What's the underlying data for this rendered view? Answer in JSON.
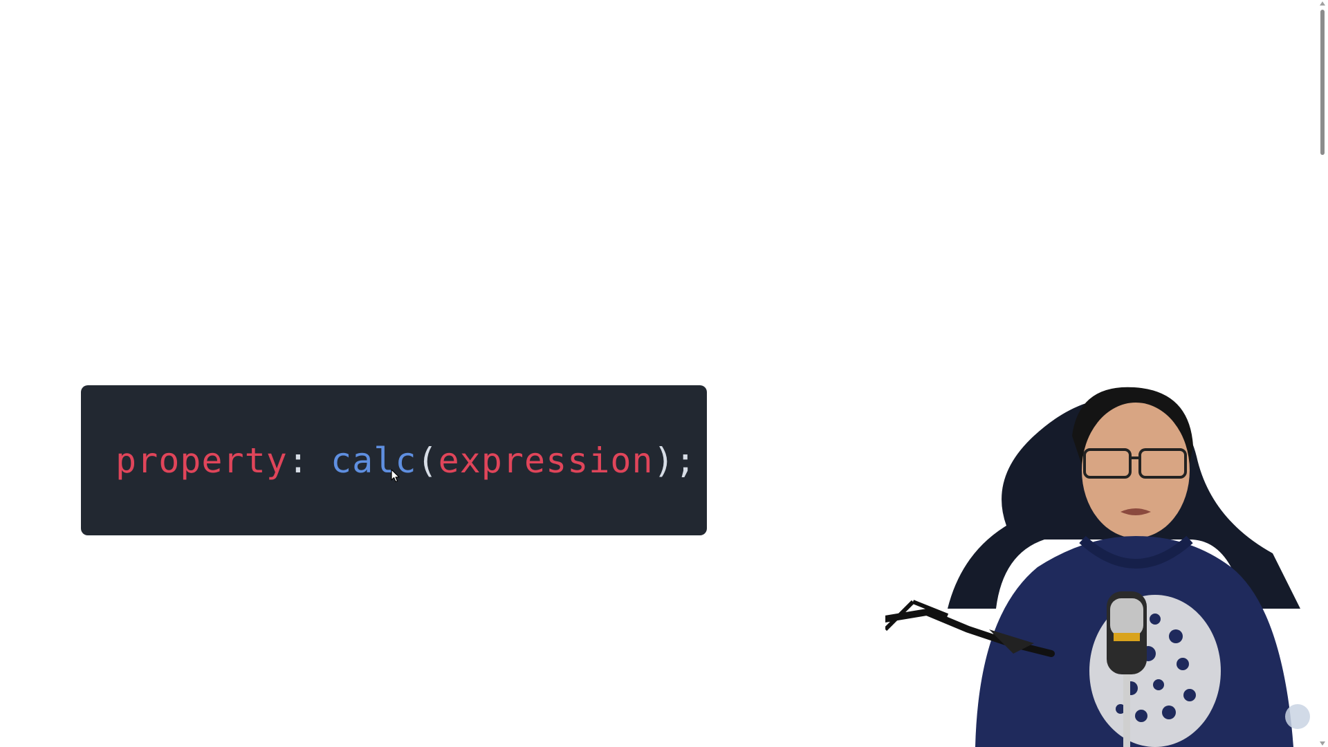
{
  "code_block": {
    "tokens": {
      "property": "property",
      "colon": ":",
      "function": "calc",
      "open_paren": "(",
      "argument": "expression",
      "close": ");"
    },
    "colors": {
      "background": "#222831",
      "property": "#e0455a",
      "function": "#5f8fe0",
      "punctuation": "#d7dde6"
    }
  },
  "presenter": {
    "icon": "presenter-webcam"
  },
  "icons": {
    "cursor": "mouse-pointer-icon",
    "scroll_up": "scroll-up-arrow-icon",
    "scroll_down": "scroll-down-arrow-icon",
    "badge": "channel-logo-icon"
  }
}
